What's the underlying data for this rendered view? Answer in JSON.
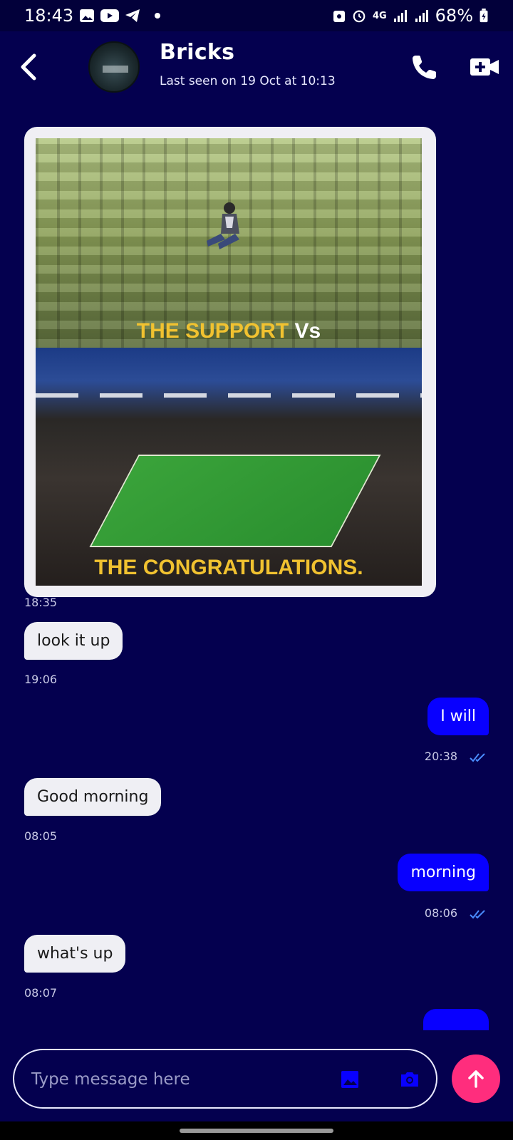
{
  "status_bar": {
    "time": "18:43",
    "network": "4G",
    "battery": "68%",
    "icons": [
      "gallery-icon",
      "youtube-icon",
      "telegram-icon",
      "notification-dot-icon",
      "android-icon",
      "alarm-icon",
      "signal-icon",
      "signal-icon",
      "battery-icon"
    ]
  },
  "header": {
    "name": "Bricks",
    "last_seen": "Last seen on 19 Oct at 10:13",
    "icons": [
      "back-arrow-icon",
      "phone-icon",
      "video-add-icon"
    ]
  },
  "messages": [
    {
      "type": "image",
      "direction": "incoming",
      "caption_top": "THE SUPPORT",
      "caption_vs": "Vs",
      "caption_bottom": "THE CONGRATULATIONS.",
      "time": "18:35"
    },
    {
      "type": "text",
      "direction": "incoming",
      "text": "look it up",
      "time": "19:06"
    },
    {
      "type": "text",
      "direction": "outgoing",
      "text": "I will",
      "time": "20:38",
      "read": true
    },
    {
      "type": "text",
      "direction": "incoming",
      "text": "Good morning",
      "time": "08:05"
    },
    {
      "type": "text",
      "direction": "outgoing",
      "text": "morning",
      "time": "08:06",
      "read": true
    },
    {
      "type": "text",
      "direction": "incoming",
      "text": "what's up",
      "time": "08:07"
    }
  ],
  "composer": {
    "placeholder": "Type message here",
    "icons": [
      "image-icon",
      "camera-icon",
      "arrow-up-icon"
    ]
  },
  "colors": {
    "background": "#04004f",
    "status_bar": "#02003a",
    "outgoing_bubble": "#0800ff",
    "incoming_bubble": "#efeff4",
    "send_button": "#ff2d7d",
    "read_tick": "#4a8cff"
  }
}
